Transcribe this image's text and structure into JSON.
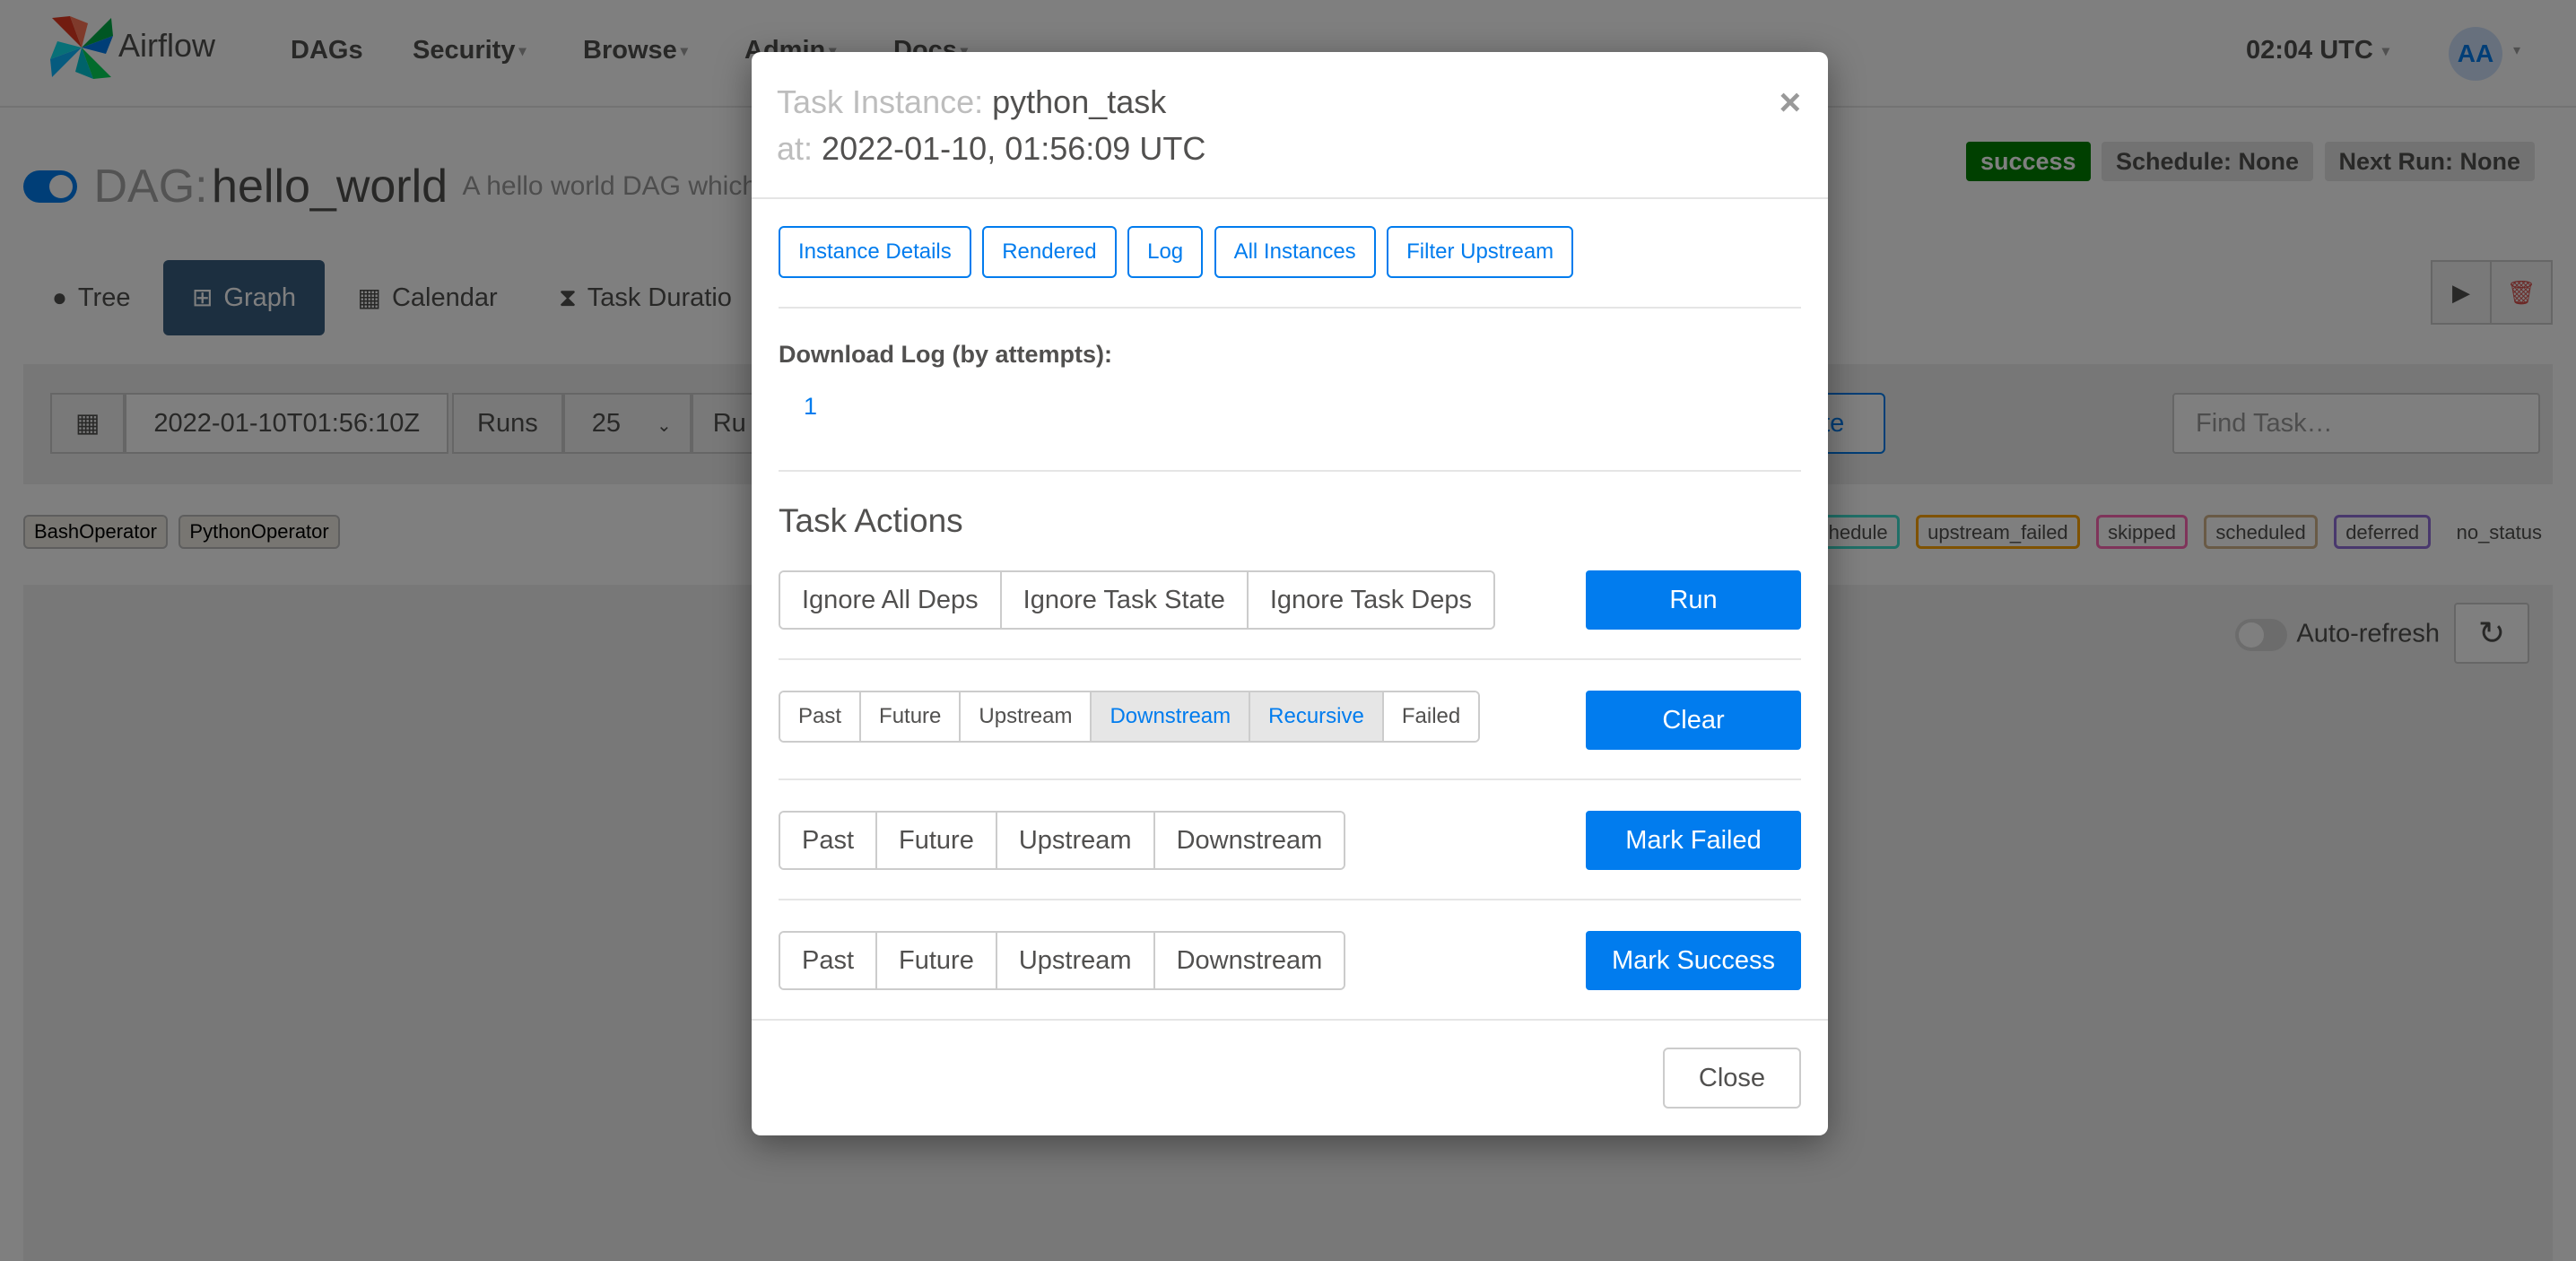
{
  "navbar": {
    "brand": "Airflow",
    "items": [
      {
        "label": "DAGs",
        "dropdown": false
      },
      {
        "label": "Security",
        "dropdown": true
      },
      {
        "label": "Browse",
        "dropdown": true
      },
      {
        "label": "Admin",
        "dropdown": true
      },
      {
        "label": "Docs",
        "dropdown": true
      }
    ],
    "clock": "02:04 UTC",
    "avatar_initials": "AA"
  },
  "dag": {
    "label": "DAG:",
    "name": "hello_world",
    "description": "A hello world DAG which",
    "badges": {
      "state": "success",
      "schedule": "Schedule: None",
      "next_run": "Next Run: None"
    }
  },
  "tabs": [
    {
      "label": "Tree",
      "icon": "tree-icon",
      "active": false
    },
    {
      "label": "Graph",
      "icon": "graph-icon",
      "active": true
    },
    {
      "label": "Calendar",
      "icon": "calendar-icon",
      "active": false
    },
    {
      "label": "Task Duratio",
      "icon": "hourglass-icon",
      "active": false
    }
  ],
  "filters": {
    "date_value": "2022-01-10T01:56:10Z",
    "runs_label": "Runs",
    "runs_value": "25",
    "run_label_partial": "Ru",
    "update_partial": "ate",
    "find_placeholder": "Find Task…"
  },
  "legend": {
    "operators": [
      "BashOperator",
      "PythonOperator"
    ],
    "states": [
      {
        "label": "_reschedule",
        "color": "#40e0d0"
      },
      {
        "label": "upstream_failed",
        "color": "#ffa500"
      },
      {
        "label": "skipped",
        "color": "#ff69b4"
      },
      {
        "label": "scheduled",
        "color": "#d2b48c"
      },
      {
        "label": "deferred",
        "color": "#9370db"
      },
      {
        "label": "no_status",
        "color": "none"
      }
    ]
  },
  "graph": {
    "auto_refresh_label": "Auto-refresh"
  },
  "modal": {
    "title_label": "Task Instance:",
    "task_id": "python_task",
    "at_label": "at:",
    "execution_date": "2022-01-10, 01:56:09 UTC",
    "close_x": "×",
    "nav_buttons": [
      "Instance Details",
      "Rendered",
      "Log",
      "All Instances",
      "Filter Upstream"
    ],
    "download_log_title": "Download Log (by attempts):",
    "attempts": [
      "1"
    ],
    "task_actions_title": "Task Actions",
    "run": {
      "options": [
        {
          "label": "Ignore All Deps",
          "active": false
        },
        {
          "label": "Ignore Task State",
          "active": false
        },
        {
          "label": "Ignore Task Deps",
          "active": false
        }
      ],
      "button": "Run"
    },
    "clear": {
      "options": [
        {
          "label": "Past",
          "active": false
        },
        {
          "label": "Future",
          "active": false
        },
        {
          "label": "Upstream",
          "active": false
        },
        {
          "label": "Downstream",
          "active": true
        },
        {
          "label": "Recursive",
          "active": true
        },
        {
          "label": "Failed",
          "active": false
        }
      ],
      "button": "Clear"
    },
    "mark_failed": {
      "options": [
        {
          "label": "Past",
          "active": false
        },
        {
          "label": "Future",
          "active": false
        },
        {
          "label": "Upstream",
          "active": false
        },
        {
          "label": "Downstream",
          "active": false
        }
      ],
      "button": "Mark Failed"
    },
    "mark_success": {
      "options": [
        {
          "label": "Past",
          "active": false
        },
        {
          "label": "Future",
          "active": false
        },
        {
          "label": "Upstream",
          "active": false
        },
        {
          "label": "Downstream",
          "active": false
        }
      ],
      "button": "Mark Success"
    },
    "close_button": "Close"
  },
  "colors": {
    "accent": "#017cee",
    "active_tab": "#385f81",
    "success": "#008000"
  }
}
